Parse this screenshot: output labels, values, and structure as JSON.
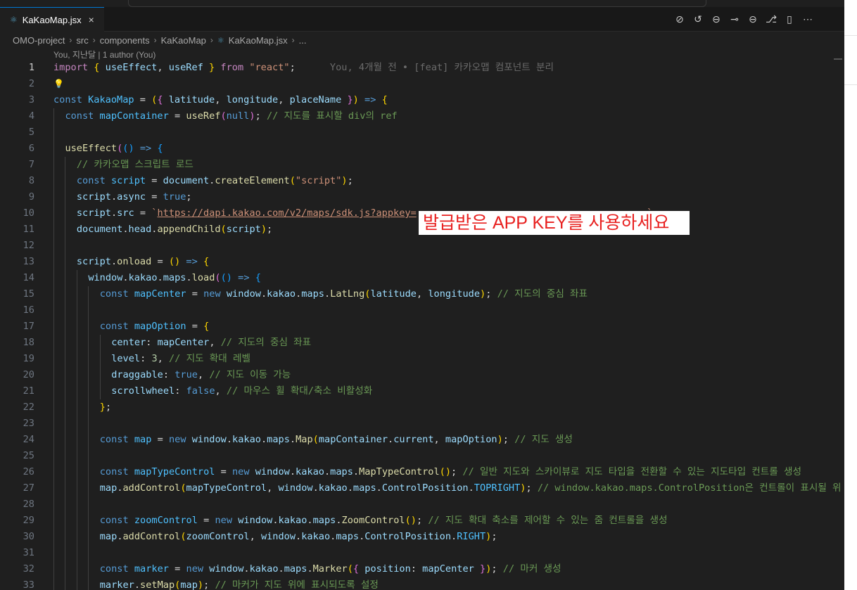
{
  "tab": {
    "icon": "react-icon",
    "label": "KaKaoMap.jsx",
    "close": "×"
  },
  "actions": [
    {
      "name": "toggle-blame-icon",
      "glyph": "⊘"
    },
    {
      "name": "timeline-icon",
      "glyph": "↺"
    },
    {
      "name": "previous-change-icon",
      "glyph": "⊖"
    },
    {
      "name": "commit-icon",
      "glyph": "⊸"
    },
    {
      "name": "next-change-icon",
      "glyph": "⊖"
    },
    {
      "name": "git-graph-icon",
      "glyph": "⎇"
    },
    {
      "name": "split-editor-icon",
      "glyph": "▯"
    },
    {
      "name": "more-actions-icon",
      "glyph": "⋯"
    }
  ],
  "breadcrumb": {
    "items": [
      "OMO-project",
      "src",
      "components",
      "KaKaoMap",
      "KaKaoMap.jsx",
      "..."
    ],
    "separator": "›"
  },
  "codelens": "You, 지난달 | 1 author (You)",
  "blame": "You, 4개월 전 • [feat] 카카오맵 컴포넌트 분리",
  "overlay_text": "발급받은 APP KEY를 사용하세요",
  "colors": {
    "editor_bg": "#1f1f1f",
    "keyword": "#569cd6",
    "control": "#c586c0",
    "function": "#dcdcaa",
    "variable": "#9cdcfe",
    "string": "#ce9178",
    "comment": "#6a9955",
    "overlay_text": "#e8201f"
  },
  "lines": [
    {
      "n": "1",
      "ind": 0,
      "t": [
        [
          "kc",
          "import "
        ],
        [
          "b1",
          "{ "
        ],
        [
          "v",
          "useEffect"
        ],
        [
          "",
          ","
        ],
        [
          "v",
          " useRef"
        ],
        [
          "b1",
          " }"
        ],
        [
          "kc",
          " from "
        ],
        [
          "s",
          "\"react\""
        ],
        [
          "",
          ";"
        ]
      ]
    },
    {
      "n": "2",
      "ind": 0,
      "t": [
        [
          "bulb",
          "💡"
        ]
      ]
    },
    {
      "n": "3",
      "ind": 0,
      "t": [
        [
          "k",
          "const "
        ],
        [
          "c",
          "KakaoMap"
        ],
        [
          "",
          " = "
        ],
        [
          "b1",
          "("
        ],
        [
          "b2",
          "{ "
        ],
        [
          "v",
          "latitude"
        ],
        [
          "",
          ", "
        ],
        [
          "v",
          "longitude"
        ],
        [
          "",
          ", "
        ],
        [
          "v",
          "placeName"
        ],
        [
          "b2",
          " }"
        ],
        [
          "b1",
          ")"
        ],
        [
          "k",
          " => "
        ],
        [
          "b1",
          "{"
        ]
      ]
    },
    {
      "n": "4",
      "ind": 1,
      "t": [
        [
          "k",
          "const "
        ],
        [
          "c",
          "mapContainer"
        ],
        [
          "",
          " = "
        ],
        [
          "f",
          "useRef"
        ],
        [
          "b2",
          "("
        ],
        [
          "k",
          "null"
        ],
        [
          "b2",
          ")"
        ],
        [
          "",
          "; "
        ],
        [
          "cm",
          "// 지도를 표시할 div의 ref"
        ]
      ]
    },
    {
      "n": "5",
      "ind": 1,
      "t": []
    },
    {
      "n": "6",
      "ind": 1,
      "t": [
        [
          "f",
          "useEffect"
        ],
        [
          "b2",
          "("
        ],
        [
          "b3",
          "()"
        ],
        [
          "k",
          " => "
        ],
        [
          "b3",
          "{"
        ]
      ]
    },
    {
      "n": "7",
      "ind": 2,
      "t": [
        [
          "cm",
          "// 카카오맵 스크립트 로드"
        ]
      ]
    },
    {
      "n": "8",
      "ind": 2,
      "t": [
        [
          "k",
          "const "
        ],
        [
          "c",
          "script"
        ],
        [
          "",
          " = "
        ],
        [
          "v",
          "document"
        ],
        [
          "",
          "."
        ],
        [
          "f",
          "createElement"
        ],
        [
          "b1",
          "("
        ],
        [
          "s",
          "\"script\""
        ],
        [
          "b1",
          ")"
        ],
        [
          "",
          ";"
        ]
      ]
    },
    {
      "n": "9",
      "ind": 2,
      "t": [
        [
          "v",
          "script"
        ],
        [
          "",
          "."
        ],
        [
          "v",
          "async"
        ],
        [
          "",
          " = "
        ],
        [
          "k",
          "true"
        ],
        [
          "",
          ";"
        ]
      ]
    },
    {
      "n": "10",
      "ind": 2,
      "t": [
        [
          "v",
          "script"
        ],
        [
          "",
          "."
        ],
        [
          "v",
          "src"
        ],
        [
          "",
          " = "
        ],
        [
          "s",
          "`"
        ],
        [
          "su",
          "https://dapi.kakao.com/v2/maps/sdk.js?appkey="
        ],
        [
          "s",
          "                                        `"
        ],
        [
          "",
          ";"
        ]
      ]
    },
    {
      "n": "11",
      "ind": 2,
      "t": [
        [
          "v",
          "document"
        ],
        [
          "",
          "."
        ],
        [
          "v",
          "head"
        ],
        [
          "",
          "."
        ],
        [
          "f",
          "appendChild"
        ],
        [
          "b1",
          "("
        ],
        [
          "v",
          "script"
        ],
        [
          "b1",
          ")"
        ],
        [
          "",
          ";"
        ]
      ]
    },
    {
      "n": "12",
      "ind": 2,
      "t": []
    },
    {
      "n": "13",
      "ind": 2,
      "t": [
        [
          "v",
          "script"
        ],
        [
          "",
          "."
        ],
        [
          "f",
          "onload"
        ],
        [
          "",
          " = "
        ],
        [
          "b1",
          "()"
        ],
        [
          "k",
          " => "
        ],
        [
          "b1",
          "{"
        ]
      ]
    },
    {
      "n": "14",
      "ind": 3,
      "t": [
        [
          "v",
          "window"
        ],
        [
          "",
          "."
        ],
        [
          "v",
          "kakao"
        ],
        [
          "",
          "."
        ],
        [
          "v",
          "maps"
        ],
        [
          "",
          "."
        ],
        [
          "f",
          "load"
        ],
        [
          "b2",
          "("
        ],
        [
          "b3",
          "()"
        ],
        [
          "k",
          " => "
        ],
        [
          "b3",
          "{"
        ]
      ]
    },
    {
      "n": "15",
      "ind": 4,
      "t": [
        [
          "k",
          "const "
        ],
        [
          "c",
          "mapCenter"
        ],
        [
          "",
          " = "
        ],
        [
          "k",
          "new "
        ],
        [
          "v",
          "window"
        ],
        [
          "",
          "."
        ],
        [
          "v",
          "kakao"
        ],
        [
          "",
          "."
        ],
        [
          "v",
          "maps"
        ],
        [
          "",
          "."
        ],
        [
          "f",
          "LatLng"
        ],
        [
          "b1",
          "("
        ],
        [
          "v",
          "latitude"
        ],
        [
          "",
          ", "
        ],
        [
          "v",
          "longitude"
        ],
        [
          "b1",
          ")"
        ],
        [
          "",
          "; "
        ],
        [
          "cm",
          "// 지도의 중심 좌표"
        ]
      ]
    },
    {
      "n": "16",
      "ind": 4,
      "t": []
    },
    {
      "n": "17",
      "ind": 4,
      "t": [
        [
          "k",
          "const "
        ],
        [
          "c",
          "mapOption"
        ],
        [
          "",
          " = "
        ],
        [
          "b1",
          "{"
        ]
      ]
    },
    {
      "n": "18",
      "ind": 5,
      "t": [
        [
          "v",
          "center"
        ],
        [
          "",
          ": "
        ],
        [
          "v",
          "mapCenter"
        ],
        [
          "",
          ", "
        ],
        [
          "cm",
          "// 지도의 중심 좌표"
        ]
      ]
    },
    {
      "n": "19",
      "ind": 5,
      "t": [
        [
          "v",
          "level"
        ],
        [
          "",
          ": "
        ],
        [
          "n",
          "3"
        ],
        [
          "",
          ", "
        ],
        [
          "cm",
          "// 지도 확대 레벨"
        ]
      ]
    },
    {
      "n": "20",
      "ind": 5,
      "t": [
        [
          "v",
          "draggable"
        ],
        [
          "",
          ": "
        ],
        [
          "k",
          "true"
        ],
        [
          "",
          ", "
        ],
        [
          "cm",
          "// 지도 이동 가능"
        ]
      ]
    },
    {
      "n": "21",
      "ind": 5,
      "t": [
        [
          "v",
          "scrollwheel"
        ],
        [
          "",
          ": "
        ],
        [
          "k",
          "false"
        ],
        [
          "",
          ", "
        ],
        [
          "cm",
          "// 마우스 휠 확대/축소 비활성화"
        ]
      ]
    },
    {
      "n": "22",
      "ind": 4,
      "t": [
        [
          "b1",
          "}"
        ],
        [
          "",
          ";"
        ]
      ]
    },
    {
      "n": "23",
      "ind": 4,
      "t": []
    },
    {
      "n": "24",
      "ind": 4,
      "t": [
        [
          "k",
          "const "
        ],
        [
          "c",
          "map"
        ],
        [
          "",
          " = "
        ],
        [
          "k",
          "new "
        ],
        [
          "v",
          "window"
        ],
        [
          "",
          "."
        ],
        [
          "v",
          "kakao"
        ],
        [
          "",
          "."
        ],
        [
          "v",
          "maps"
        ],
        [
          "",
          "."
        ],
        [
          "f",
          "Map"
        ],
        [
          "b1",
          "("
        ],
        [
          "v",
          "mapContainer"
        ],
        [
          "",
          "."
        ],
        [
          "v",
          "current"
        ],
        [
          "",
          ", "
        ],
        [
          "v",
          "mapOption"
        ],
        [
          "b1",
          ")"
        ],
        [
          "",
          "; "
        ],
        [
          "cm",
          "// 지도 생성"
        ]
      ]
    },
    {
      "n": "25",
      "ind": 4,
      "t": []
    },
    {
      "n": "26",
      "ind": 4,
      "t": [
        [
          "k",
          "const "
        ],
        [
          "c",
          "mapTypeControl"
        ],
        [
          "",
          " = "
        ],
        [
          "k",
          "new "
        ],
        [
          "v",
          "window"
        ],
        [
          "",
          "."
        ],
        [
          "v",
          "kakao"
        ],
        [
          "",
          "."
        ],
        [
          "v",
          "maps"
        ],
        [
          "",
          "."
        ],
        [
          "f",
          "MapTypeControl"
        ],
        [
          "b1",
          "()"
        ],
        [
          "",
          "; "
        ],
        [
          "cm",
          "// 일반 지도와 스카이뷰로 지도 타입을 전환할 수 있는 지도타입 컨트롤 생성"
        ]
      ]
    },
    {
      "n": "27",
      "ind": 4,
      "t": [
        [
          "v",
          "map"
        ],
        [
          "",
          "."
        ],
        [
          "f",
          "addControl"
        ],
        [
          "b1",
          "("
        ],
        [
          "v",
          "mapTypeControl"
        ],
        [
          "",
          ", "
        ],
        [
          "v",
          "window"
        ],
        [
          "",
          "."
        ],
        [
          "v",
          "kakao"
        ],
        [
          "",
          "."
        ],
        [
          "v",
          "maps"
        ],
        [
          "",
          "."
        ],
        [
          "v",
          "ControlPosition"
        ],
        [
          "",
          "."
        ],
        [
          "c",
          "TOPRIGHT"
        ],
        [
          "b1",
          ")"
        ],
        [
          "",
          "; "
        ],
        [
          "cm",
          "// window.kakao.maps.ControlPosition은 컨트롤이 표시될 위"
        ]
      ]
    },
    {
      "n": "28",
      "ind": 4,
      "t": []
    },
    {
      "n": "29",
      "ind": 4,
      "t": [
        [
          "k",
          "const "
        ],
        [
          "c",
          "zoomControl"
        ],
        [
          "",
          " = "
        ],
        [
          "k",
          "new "
        ],
        [
          "v",
          "window"
        ],
        [
          "",
          "."
        ],
        [
          "v",
          "kakao"
        ],
        [
          "",
          "."
        ],
        [
          "v",
          "maps"
        ],
        [
          "",
          "."
        ],
        [
          "f",
          "ZoomControl"
        ],
        [
          "b1",
          "()"
        ],
        [
          "",
          "; "
        ],
        [
          "cm",
          "// 지도 확대 축소를 제어할 수 있는 줌 컨트롤을 생성"
        ]
      ]
    },
    {
      "n": "30",
      "ind": 4,
      "t": [
        [
          "v",
          "map"
        ],
        [
          "",
          "."
        ],
        [
          "f",
          "addControl"
        ],
        [
          "b1",
          "("
        ],
        [
          "v",
          "zoomControl"
        ],
        [
          "",
          ", "
        ],
        [
          "v",
          "window"
        ],
        [
          "",
          "."
        ],
        [
          "v",
          "kakao"
        ],
        [
          "",
          "."
        ],
        [
          "v",
          "maps"
        ],
        [
          "",
          "."
        ],
        [
          "v",
          "ControlPosition"
        ],
        [
          "",
          "."
        ],
        [
          "c",
          "RIGHT"
        ],
        [
          "b1",
          ")"
        ],
        [
          "",
          ";"
        ]
      ]
    },
    {
      "n": "31",
      "ind": 4,
      "t": []
    },
    {
      "n": "32",
      "ind": 4,
      "t": [
        [
          "k",
          "const "
        ],
        [
          "c",
          "marker"
        ],
        [
          "",
          " = "
        ],
        [
          "k",
          "new "
        ],
        [
          "v",
          "window"
        ],
        [
          "",
          "."
        ],
        [
          "v",
          "kakao"
        ],
        [
          "",
          "."
        ],
        [
          "v",
          "maps"
        ],
        [
          "",
          "."
        ],
        [
          "f",
          "Marker"
        ],
        [
          "b1",
          "("
        ],
        [
          "b2",
          "{ "
        ],
        [
          "v",
          "position"
        ],
        [
          "",
          ": "
        ],
        [
          "v",
          "mapCenter"
        ],
        [
          "b2",
          " }"
        ],
        [
          "b1",
          ")"
        ],
        [
          "",
          "; "
        ],
        [
          "cm",
          "// 마커 생성"
        ]
      ]
    },
    {
      "n": "33",
      "ind": 4,
      "t": [
        [
          "v",
          "marker"
        ],
        [
          "",
          "."
        ],
        [
          "f",
          "setMap"
        ],
        [
          "b1",
          "("
        ],
        [
          "v",
          "map"
        ],
        [
          "b1",
          ")"
        ],
        [
          "",
          "; "
        ],
        [
          "cm",
          "// 마커가 지도 위에 표시되도록 설정"
        ]
      ]
    }
  ]
}
